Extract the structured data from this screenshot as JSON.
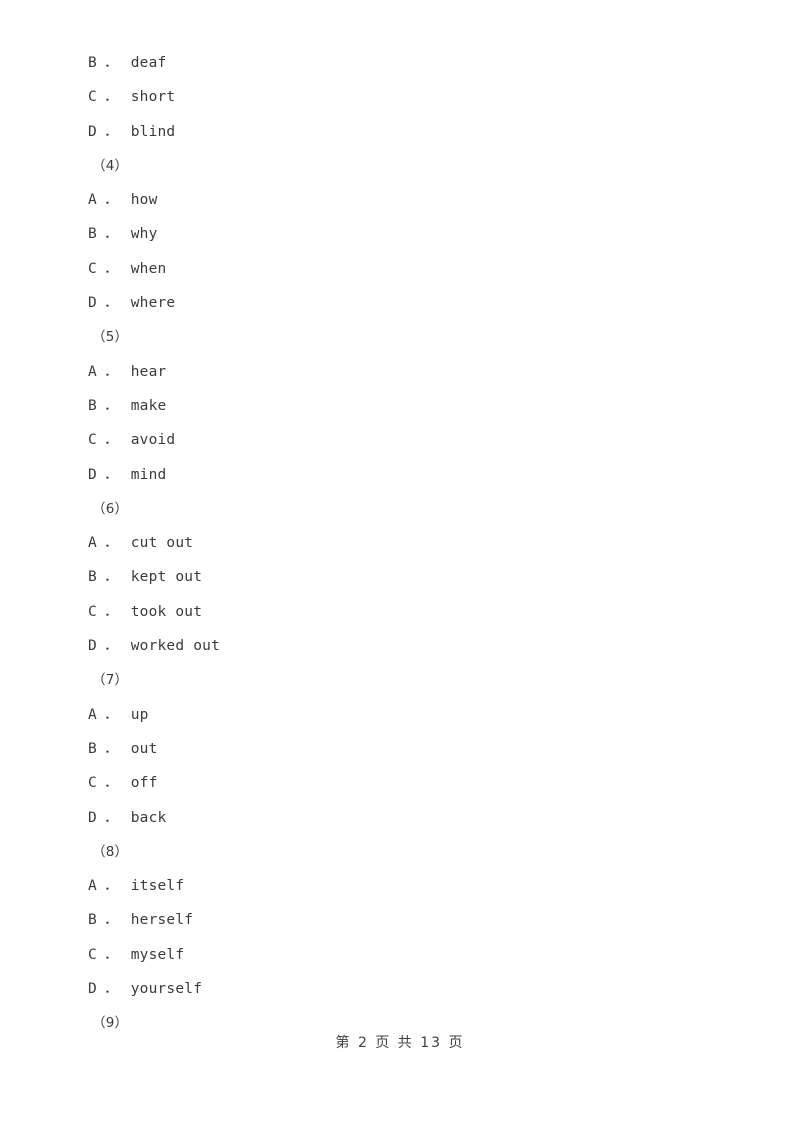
{
  "document": {
    "page_label": "第 2 页 共 13 页",
    "page_number": "2",
    "total_pages": "13",
    "text_color": "#3b3b3b",
    "background_color": "#ffffff"
  },
  "lines": [
    {
      "kind": "option",
      "letter": "B",
      "dot": "．",
      "text": "deaf"
    },
    {
      "kind": "option",
      "letter": "C",
      "dot": "．",
      "text": "short"
    },
    {
      "kind": "option",
      "letter": "D",
      "dot": "．",
      "text": "blind"
    },
    {
      "kind": "qnum",
      "label": "（4）"
    },
    {
      "kind": "option",
      "letter": "A",
      "dot": "．",
      "text": "how"
    },
    {
      "kind": "option",
      "letter": "B",
      "dot": "．",
      "text": "why"
    },
    {
      "kind": "option",
      "letter": "C",
      "dot": "．",
      "text": "when"
    },
    {
      "kind": "option",
      "letter": "D",
      "dot": "．",
      "text": "where"
    },
    {
      "kind": "qnum",
      "label": "（5）"
    },
    {
      "kind": "option",
      "letter": "A",
      "dot": "．",
      "text": "hear"
    },
    {
      "kind": "option",
      "letter": "B",
      "dot": "．",
      "text": "make"
    },
    {
      "kind": "option",
      "letter": "C",
      "dot": "．",
      "text": "avoid"
    },
    {
      "kind": "option",
      "letter": "D",
      "dot": "．",
      "text": "mind"
    },
    {
      "kind": "qnum",
      "label": "（6）"
    },
    {
      "kind": "option",
      "letter": "A",
      "dot": "．",
      "text": "cut out"
    },
    {
      "kind": "option",
      "letter": "B",
      "dot": "．",
      "text": "kept out"
    },
    {
      "kind": "option",
      "letter": "C",
      "dot": "．",
      "text": "took out"
    },
    {
      "kind": "option",
      "letter": "D",
      "dot": "．",
      "text": "worked out"
    },
    {
      "kind": "qnum",
      "label": "（7）"
    },
    {
      "kind": "option",
      "letter": "A",
      "dot": "．",
      "text": "up"
    },
    {
      "kind": "option",
      "letter": "B",
      "dot": "．",
      "text": "out"
    },
    {
      "kind": "option",
      "letter": "C",
      "dot": "．",
      "text": "off"
    },
    {
      "kind": "option",
      "letter": "D",
      "dot": "．",
      "text": "back"
    },
    {
      "kind": "qnum",
      "label": "（8）"
    },
    {
      "kind": "option",
      "letter": "A",
      "dot": "．",
      "text": "itself"
    },
    {
      "kind": "option",
      "letter": "B",
      "dot": "．",
      "text": "herself"
    },
    {
      "kind": "option",
      "letter": "C",
      "dot": "．",
      "text": "myself"
    },
    {
      "kind": "option",
      "letter": "D",
      "dot": "．",
      "text": "yourself"
    },
    {
      "kind": "qnum",
      "label": "（9）"
    }
  ]
}
